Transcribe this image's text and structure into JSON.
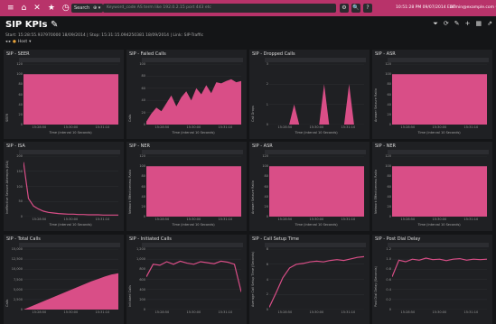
{
  "topbar": {
    "icons": [
      "hamburger-icon",
      "home-icon",
      "close-icon",
      "star-icon",
      "clock-icon"
    ],
    "search_label": "Search ▾",
    "search_label2": "⊕ ▾",
    "search_text": "Keyword_code AS term like 192.0.2.15 port 443 etc",
    "right_text": "10:51:28 PM 09/07/2014 EDT",
    "right_user": "admin@example.com ▾",
    "btns": [
      "⚙",
      "🔍",
      "?"
    ]
  },
  "header": {
    "title": "SIP KPIs ✎",
    "subtitle": "Start: 15:28:55.937970000 18/09/2014 | Stop: 15:31:15.094250381 18/09/2014 | Link: SIP-Traffic",
    "filter_label": "Host",
    "tools": [
      "funnel-icon",
      "refresh-icon",
      "edit-icon",
      "plus-icon",
      "grid-icon",
      "share-icon"
    ]
  },
  "colors": {
    "accent": "#d94e87",
    "topbar": "#b8336a",
    "panel": "#1f2023",
    "bg": "#141517"
  },
  "panels": [
    {
      "title": "SIP - SEER",
      "type": "flat"
    },
    {
      "title": "SIP - Failed Calls",
      "type": "mountain"
    },
    {
      "title": "SIP - Dropped Calls",
      "type": "spikes"
    },
    {
      "title": "SIP - ASR",
      "type": "flat"
    },
    {
      "title": "SIP - ISA",
      "type": "decay"
    },
    {
      "title": "SIP - NER",
      "type": "flat"
    },
    {
      "title": "SIP - ASR",
      "type": "flat"
    },
    {
      "title": "SIP - NER",
      "type": "flat"
    },
    {
      "title": "SIP - Total Calls",
      "type": "ramp"
    },
    {
      "title": "SIP - Initiated Calls",
      "type": "wavy"
    },
    {
      "title": "SIP - Call Setup Time",
      "type": "rise"
    },
    {
      "title": "SIP - Post Dial Delay",
      "type": "noisyflat"
    }
  ],
  "chart_data": [
    {
      "type": "area",
      "title": "SIP - SEER",
      "ylabel": "SEER",
      "xlabel": "Time (interval 10 Seconds)",
      "ylim": [
        0,
        120
      ],
      "yticks": [
        "0",
        "20",
        "40",
        "60",
        "80",
        "100",
        "120"
      ],
      "xticks": [
        "15:28:50",
        "15:30:00",
        "15:31:10"
      ],
      "series": [
        {
          "values": [
            100,
            100,
            100,
            100,
            100,
            100,
            100,
            100,
            100,
            100
          ]
        }
      ]
    },
    {
      "type": "area",
      "title": "SIP - Failed Calls",
      "ylabel": "Calls",
      "xlabel": "Time (interval 10 Seconds)",
      "ylim": [
        0,
        100
      ],
      "yticks": [
        "0",
        "20",
        "40",
        "60",
        "80",
        "100"
      ],
      "xticks": [
        "15:28:50",
        "15:30:00",
        "15:31:10"
      ],
      "series": [
        {
          "values": [
            5,
            18,
            28,
            22,
            35,
            48,
            30,
            45,
            55,
            40,
            60,
            50,
            65,
            52,
            70,
            68,
            72,
            75,
            70,
            72
          ]
        }
      ]
    },
    {
      "type": "area",
      "title": "SIP - Dropped Calls",
      "ylabel": "Call Drops",
      "xlabel": "Time (interval 10 Seconds)",
      "ylim": [
        0,
        3
      ],
      "yticks": [
        "0",
        "1",
        "2",
        "3"
      ],
      "xticks": [
        "15:28:50",
        "15:30:00",
        "15:31:10"
      ],
      "series": [
        {
          "values": [
            0,
            0,
            0,
            0,
            0,
            1,
            0,
            0,
            0,
            0,
            0,
            2,
            0,
            0,
            0,
            0,
            2,
            0,
            0,
            0
          ]
        }
      ]
    },
    {
      "type": "area",
      "title": "SIP - ASR",
      "ylabel": "Answer Seizure Ratio",
      "xlabel": "Time (interval 10 Seconds)",
      "ylim": [
        0,
        120
      ],
      "yticks": [
        "0",
        "20",
        "40",
        "60",
        "80",
        "100",
        "120"
      ],
      "xticks": [
        "15:28:50",
        "15:30:00",
        "15:31:10"
      ],
      "series": [
        {
          "values": [
            100,
            100,
            100,
            100,
            100,
            100,
            100,
            100,
            100,
            100
          ]
        }
      ]
    },
    {
      "type": "line",
      "title": "SIP - ISA",
      "ylabel": "Ineffective Seizure Attempts (ISA)",
      "xlabel": "Time (interval 10 Seconds)",
      "ylim": [
        0,
        200
      ],
      "yticks": [
        "0",
        "50",
        "100",
        "150",
        "200"
      ],
      "xticks": [
        "15:28:50",
        "15:30:00",
        "15:31:10"
      ],
      "series": [
        {
          "values": [
            180,
            60,
            35,
            25,
            18,
            14,
            12,
            10,
            9,
            8,
            8,
            7,
            7,
            6,
            6,
            6,
            5,
            5,
            5,
            5
          ]
        }
      ]
    },
    {
      "type": "area",
      "title": "SIP - NER",
      "ylabel": "Network Effectiveness Ratio",
      "xlabel": "Time (interval 10 Seconds)",
      "ylim": [
        0,
        120
      ],
      "yticks": [
        "0",
        "20",
        "40",
        "60",
        "80",
        "100",
        "120"
      ],
      "xticks": [
        "15:28:50",
        "15:30:00",
        "15:31:10"
      ],
      "series": [
        {
          "values": [
            100,
            100,
            100,
            100,
            100,
            100,
            100,
            100,
            100,
            100
          ]
        }
      ]
    },
    {
      "type": "area",
      "title": "SIP - ASR",
      "ylabel": "Answer Seizure Ratio",
      "xlabel": "Time (interval 10 Seconds)",
      "ylim": [
        0,
        120
      ],
      "yticks": [
        "0",
        "20",
        "40",
        "60",
        "80",
        "100",
        "120"
      ],
      "xticks": [
        "15:28:50",
        "15:30:00",
        "15:31:10"
      ],
      "series": [
        {
          "values": [
            100,
            100,
            100,
            100,
            100,
            100,
            100,
            100,
            100,
            100
          ]
        }
      ]
    },
    {
      "type": "area",
      "title": "SIP - NER",
      "ylabel": "Network Effectiveness Ratio",
      "xlabel": "Time (interval 10 Seconds)",
      "ylim": [
        0,
        120
      ],
      "yticks": [
        "0",
        "20",
        "40",
        "60",
        "80",
        "100",
        "120"
      ],
      "xticks": [
        "15:28:50",
        "15:30:00",
        "15:31:10"
      ],
      "series": [
        {
          "values": [
            100,
            100,
            100,
            100,
            100,
            100,
            100,
            100,
            100,
            100
          ]
        }
      ]
    },
    {
      "type": "area",
      "title": "SIP - Total Calls",
      "ylabel": "Calls",
      "xlabel": "",
      "ylim": [
        0,
        15000
      ],
      "yticks": [
        "0",
        "2,500",
        "5,000",
        "7,500",
        "10,000",
        "12,500",
        "15,000"
      ],
      "xticks": [
        "15:28:50",
        "15:30:00",
        "15:31:10"
      ],
      "series": [
        {
          "values": [
            0,
            700,
            1400,
            2100,
            2800,
            3500,
            4200,
            4900,
            5600,
            6300,
            7000,
            7600,
            8200,
            8700,
            9000
          ]
        }
      ]
    },
    {
      "type": "line",
      "title": "SIP - Initiated Calls",
      "ylabel": "Initiated Calls",
      "xlabel": "",
      "ylim": [
        0,
        1200
      ],
      "yticks": [
        "0",
        "200",
        "400",
        "600",
        "800",
        "1,000",
        "1,200"
      ],
      "xticks": [
        "15:28:50",
        "15:30:00",
        "15:31:10"
      ],
      "series": [
        {
          "values": [
            650,
            900,
            880,
            950,
            900,
            960,
            920,
            900,
            950,
            930,
            910,
            960,
            940,
            900,
            350
          ]
        }
      ]
    },
    {
      "type": "line",
      "title": "SIP - Call Setup Time",
      "ylabel": "Average Call Setup Time (Seconds)",
      "xlabel": "",
      "ylim": [
        0,
        8
      ],
      "yticks": [
        "0",
        "2",
        "4",
        "6",
        "8"
      ],
      "xticks": [
        "15:28:50",
        "15:30:00",
        "15:31:10"
      ],
      "series": [
        {
          "values": [
            0.3,
            2.2,
            4.2,
            5.5,
            6.0,
            6.1,
            6.3,
            6.4,
            6.3,
            6.5,
            6.6,
            6.5,
            6.7,
            6.9,
            7.0
          ]
        }
      ]
    },
    {
      "type": "line",
      "title": "SIP - Post Dial Delay",
      "ylabel": "Post Dial Delay (Seconds)",
      "xlabel": "",
      "ylim": [
        0,
        1.2
      ],
      "yticks": [
        "0",
        "0.2",
        "0.4",
        "0.6",
        "0.8",
        "1.0",
        "1.2"
      ],
      "xticks": [
        "15:28:50",
        "15:30:00",
        "15:31:10"
      ],
      "series": [
        {
          "values": [
            0.65,
            0.98,
            0.95,
            1.0,
            0.98,
            1.02,
            0.99,
            1.0,
            0.97,
            1.0,
            1.01,
            0.98,
            1.0,
            0.99,
            1.0
          ]
        }
      ]
    }
  ]
}
